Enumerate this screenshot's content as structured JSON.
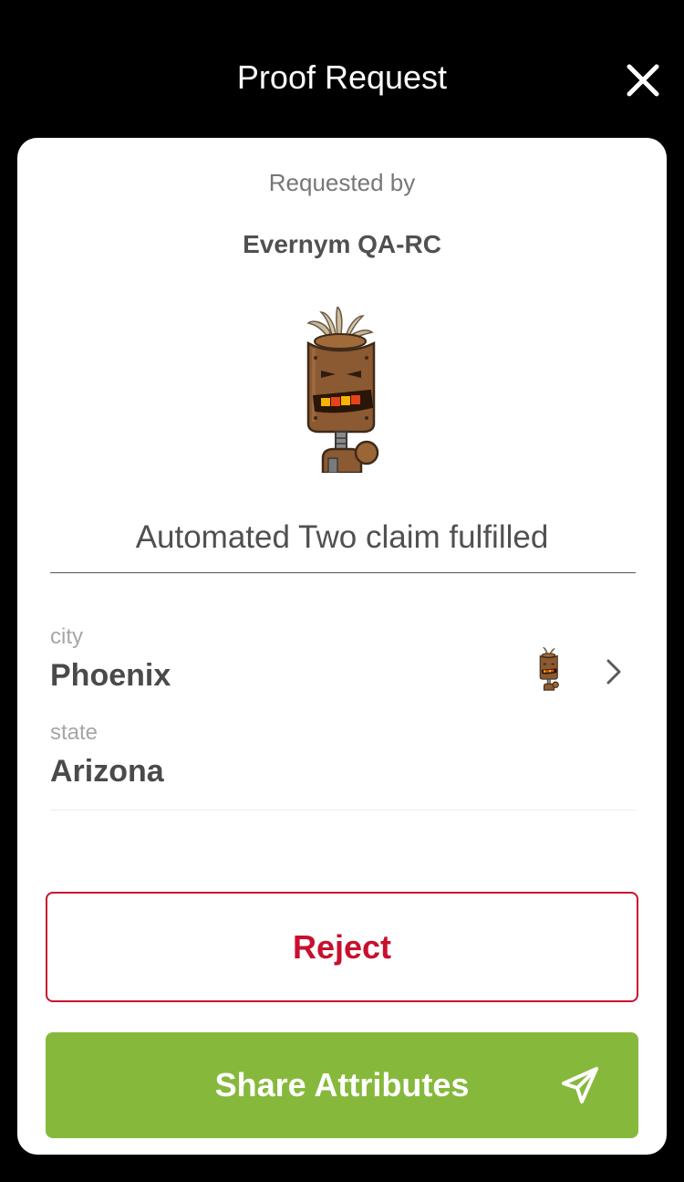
{
  "header": {
    "title": "Proof Request",
    "close_icon": "close-icon"
  },
  "request": {
    "requested_by_label": "Requested by",
    "requester_name": "Evernym QA-RC",
    "avatar_icon": "tiki-robot-avatar",
    "title": "Automated Two claim fulfilled"
  },
  "attributes": [
    {
      "label": "city",
      "value": "Phoenix"
    },
    {
      "label": "state",
      "value": "Arizona"
    }
  ],
  "attribute_source_icon": "tiki-robot-avatar",
  "actions": {
    "reject_label": "Reject",
    "share_label": "Share Attributes",
    "share_icon": "send-icon"
  },
  "colors": {
    "background": "#000000",
    "card": "#ffffff",
    "reject": "#c8102e",
    "share": "#86b93b"
  }
}
